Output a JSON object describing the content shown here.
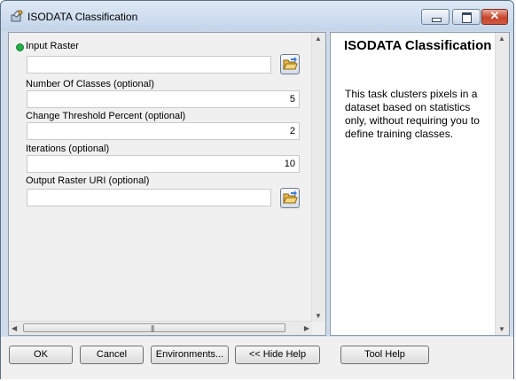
{
  "window": {
    "title": "ISODATA Classification"
  },
  "params": {
    "input_raster": {
      "label": "Input Raster",
      "value": ""
    },
    "num_classes": {
      "label": "Number Of Classes (optional)",
      "value": "5"
    },
    "change_threshold": {
      "label": "Change Threshold Percent (optional)",
      "value": "2"
    },
    "iterations": {
      "label": "Iterations (optional)",
      "value": "10"
    },
    "output_uri": {
      "label": "Output Raster URI (optional)",
      "value": ""
    }
  },
  "help": {
    "title": "ISODATA Classification",
    "text": "This task clusters pixels in a dataset based on statistics only, without requiring you to define training classes."
  },
  "buttons": {
    "ok": "OK",
    "cancel": "Cancel",
    "environments": "Environments...",
    "hide_help": "<< Hide Help",
    "tool_help": "Tool Help"
  },
  "icons": {
    "app": "toolbox-icon",
    "folder": "open-folder-icon",
    "required": "required-dot-icon"
  },
  "colors": {
    "required_dot": "#22b04a",
    "close_button": "#c6452e"
  }
}
